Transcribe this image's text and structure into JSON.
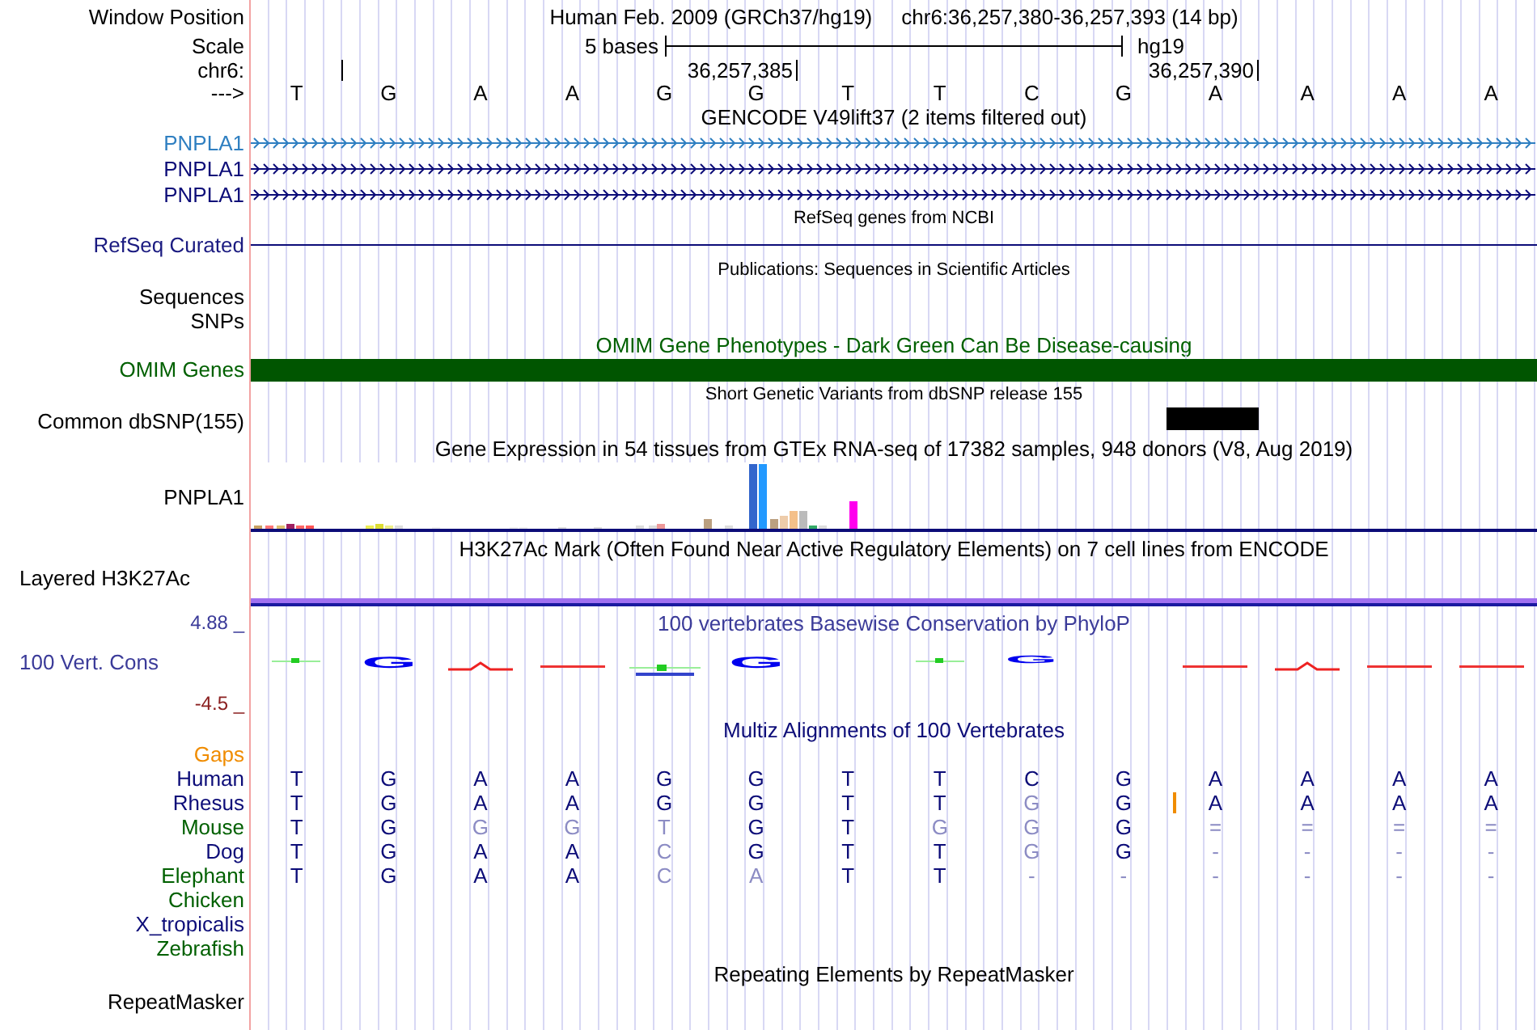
{
  "header": {
    "position_label": "Window Position",
    "assembly": "Human Feb. 2009 (GRCh37/hg19)",
    "position": "chr6:36,257,380-36,257,393 (14 bp)",
    "scale_label": "Scale",
    "scale_text": "5 bases",
    "scale_db": "hg19",
    "chrom_label": "chr6:",
    "ticks": [
      "36,257,385",
      "36,257,390"
    ],
    "strand_label": "--->",
    "bases": [
      "T",
      "G",
      "A",
      "A",
      "G",
      "G",
      "T",
      "T",
      "C",
      "G",
      "A",
      "A",
      "A",
      "A"
    ]
  },
  "tracks": [
    {
      "kind": "gene",
      "title": "GENCODE V49lift37 (2 items filtered out)",
      "items": [
        {
          "label": "PNPLA1",
          "color": "#2f7fc1"
        },
        {
          "label": "PNPLA1",
          "color": "#0c0c78"
        },
        {
          "label": "PNPLA1",
          "color": "#0c0c78"
        }
      ]
    },
    {
      "kind": "line",
      "title": "RefSeq genes from NCBI",
      "label": "RefSeq Curated"
    },
    {
      "kind": "empty",
      "title": "Publications: Sequences in Scientific Articles",
      "labels": [
        "Sequences",
        "SNPs"
      ]
    },
    {
      "kind": "bar",
      "title": "OMIM Gene Phenotypes - Dark Green Can Be Disease-causing",
      "label": "OMIM Genes"
    },
    {
      "kind": "variant",
      "title": "Short Genetic Variants from dbSNP release 155",
      "label": "Common dbSNP(155)"
    },
    {
      "kind": "expression",
      "title": "Gene Expression in 54 tissues from GTEx RNA-seq of 17382 samples, 948 donors (V8, Aug 2019)",
      "label": "PNPLA1"
    },
    {
      "kind": "signal",
      "title": "H3K27Ac Mark (Often Found Near Active Regulatory Elements) on 7 cell lines from ENCODE",
      "label": "Layered H3K27Ac"
    },
    {
      "kind": "conservation",
      "title": "100 vertebrates Basewise Conservation by PhyloP",
      "label": "100 Vert. Cons",
      "ymax": "4.88 _",
      "ymin": "-4.5 _",
      "marks": [
        {
          "kind": "green-dot"
        },
        {
          "kind": "letter",
          "base": "G"
        },
        {
          "kind": "red-peak"
        },
        {
          "kind": "red-line"
        },
        {
          "kind": "mixed"
        },
        {
          "kind": "letter",
          "base": "G"
        },
        {
          "kind": "none"
        },
        {
          "kind": "green-dot"
        },
        {
          "kind": "flat-letter",
          "base": "G"
        },
        {
          "kind": "none"
        },
        {
          "kind": "red-line"
        },
        {
          "kind": "red-peak"
        },
        {
          "kind": "red-line"
        },
        {
          "kind": "red-line"
        }
      ]
    },
    {
      "kind": "alignment",
      "title": "Multiz Alignments of 100 Vertebrates",
      "gaps_label": "Gaps",
      "species": [
        {
          "name": "Human",
          "color": "#0c0c78",
          "bases": [
            {
              "b": "T",
              "match": true
            },
            {
              "b": "G",
              "match": true
            },
            {
              "b": "A",
              "match": true
            },
            {
              "b": "A",
              "match": true
            },
            {
              "b": "G",
              "match": true
            },
            {
              "b": "G",
              "match": true
            },
            {
              "b": "T",
              "match": true
            },
            {
              "b": "T",
              "match": true
            },
            {
              "b": "C",
              "match": true
            },
            {
              "b": "G",
              "match": true
            },
            {
              "b": "A",
              "match": true
            },
            {
              "b": "A",
              "match": true
            },
            {
              "b": "A",
              "match": true
            },
            {
              "b": "A",
              "match": true
            }
          ]
        },
        {
          "name": "Rhesus",
          "color": "#0c0c78",
          "bases": [
            {
              "b": "T",
              "match": true
            },
            {
              "b": "G",
              "match": true
            },
            {
              "b": "A",
              "match": true
            },
            {
              "b": "A",
              "match": true
            },
            {
              "b": "G",
              "match": true
            },
            {
              "b": "G",
              "match": true
            },
            {
              "b": "T",
              "match": true
            },
            {
              "b": "T",
              "match": true
            },
            {
              "b": "G",
              "match": false
            },
            {
              "b": "G",
              "match": true,
              "insert": true
            },
            {
              "b": "A",
              "match": true
            },
            {
              "b": "A",
              "match": true
            },
            {
              "b": "A",
              "match": true
            },
            {
              "b": "A",
              "match": true
            }
          ]
        },
        {
          "name": "Mouse",
          "color": "#006000",
          "bases": [
            {
              "b": "T",
              "match": true
            },
            {
              "b": "G",
              "match": true
            },
            {
              "b": "G",
              "match": false
            },
            {
              "b": "G",
              "match": false
            },
            {
              "b": "T",
              "match": false
            },
            {
              "b": "G",
              "match": true
            },
            {
              "b": "T",
              "match": true
            },
            {
              "b": "G",
              "match": false
            },
            {
              "b": "G",
              "match": false
            },
            {
              "b": "G",
              "match": true
            },
            {
              "b": "=",
              "match": false
            },
            {
              "b": "=",
              "match": false
            },
            {
              "b": "=",
              "match": false
            },
            {
              "b": "=",
              "match": false
            }
          ]
        },
        {
          "name": "Dog",
          "color": "#0c0c78",
          "bases": [
            {
              "b": "T",
              "match": true
            },
            {
              "b": "G",
              "match": true
            },
            {
              "b": "A",
              "match": true
            },
            {
              "b": "A",
              "match": true
            },
            {
              "b": "C",
              "match": false
            },
            {
              "b": "G",
              "match": true
            },
            {
              "b": "T",
              "match": true
            },
            {
              "b": "T",
              "match": true
            },
            {
              "b": "G",
              "match": false
            },
            {
              "b": "G",
              "match": true
            },
            {
              "b": "-",
              "match": false
            },
            {
              "b": "-",
              "match": false
            },
            {
              "b": "-",
              "match": false
            },
            {
              "b": "-",
              "match": false
            }
          ]
        },
        {
          "name": "Elephant",
          "color": "#006000",
          "bases": [
            {
              "b": "T",
              "match": true
            },
            {
              "b": "G",
              "match": true
            },
            {
              "b": "A",
              "match": true
            },
            {
              "b": "A",
              "match": true
            },
            {
              "b": "C",
              "match": false
            },
            {
              "b": "A",
              "match": false
            },
            {
              "b": "T",
              "match": true
            },
            {
              "b": "T",
              "match": true
            },
            {
              "b": "-",
              "match": false
            },
            {
              "b": "-",
              "match": false
            },
            {
              "b": "-",
              "match": false
            },
            {
              "b": "-",
              "match": false
            },
            {
              "b": "-",
              "match": false
            },
            {
              "b": "-",
              "match": false
            }
          ]
        },
        {
          "name": "Chicken",
          "color": "#006000"
        },
        {
          "name": "X_tropicalis",
          "color": "#0c0c78"
        },
        {
          "name": "Zebrafish",
          "color": "#006000"
        }
      ]
    },
    {
      "kind": "repeat",
      "title": "Repeating Elements by RepeatMasker",
      "label": "RepeatMasker"
    }
  ]
}
